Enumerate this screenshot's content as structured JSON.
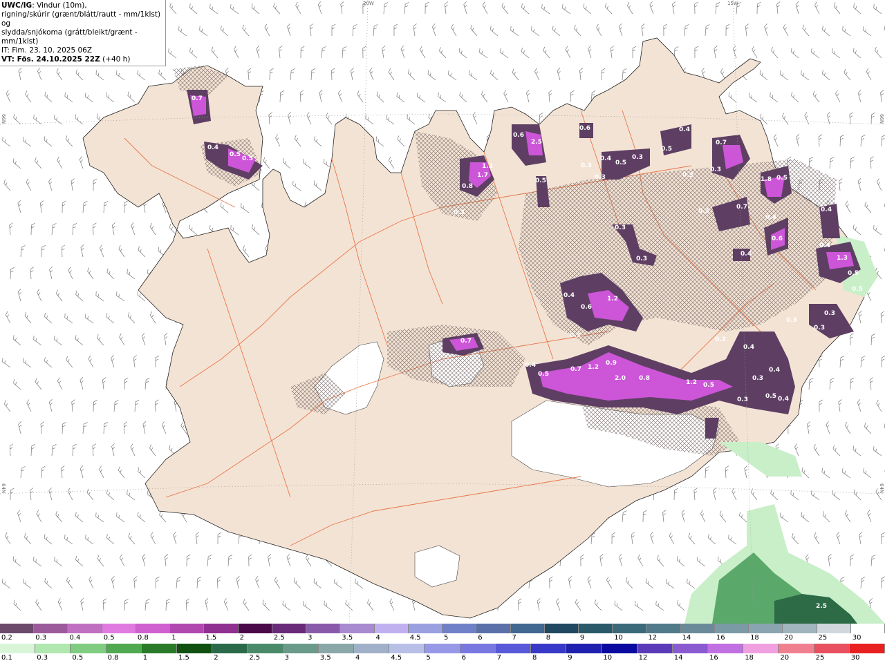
{
  "header": {
    "model": "UWC/IG",
    "desc1": ": Vindur (10m),",
    "desc2": "rigning/skúrir (grænt/blátt/rautt - mm/1klst) og",
    "desc3": "slydda/snjókoma (grátt/bleikt/grænt - mm/1klst)",
    "it": "IT: Fim. 23. 10. 2025 06Z",
    "vt_label": "VT: Fös. 24.10.2025 22Z",
    "vt_offset": "(+40 h)"
  },
  "graticule": {
    "lon_20w": "20W",
    "lon_15w": "15W",
    "lat_66n_left": "66N",
    "lat_66n_right": "66N",
    "lat_64n_left": "64N",
    "lat_64n_right": "64N"
  },
  "field_labels": [
    "0.7",
    "0.4",
    "0.5",
    "0.5",
    "0.6",
    "2.5",
    "1.2",
    "1.7",
    "0.8",
    "0.5",
    "0.3",
    "0.6",
    "0.3",
    "0.4",
    "0.5",
    "0.3",
    "0.3",
    "0.4",
    "0.5",
    "0.7",
    "0.3",
    "0.3",
    "1.8",
    "0.5",
    "0.3",
    "0.7",
    "0.4",
    "0.4",
    "0.6",
    "0.3",
    "0.3",
    "0.4",
    "0.4",
    "1.3",
    "0.5",
    "0.5",
    "0.4",
    "0.6",
    "1.2",
    "0.3",
    "0.7",
    "0.4",
    "0.5",
    "0.7",
    "1.2",
    "0.9",
    "2.0",
    "0.8",
    "1.2",
    "0.5",
    "0.2",
    "0.4",
    "0.3",
    "0.4",
    "0.5",
    "0.4",
    "0.3",
    "0.3",
    "0.3",
    "0.3",
    "2.5"
  ],
  "snow_scale": {
    "labels": [
      "0.2",
      "0.3",
      "0.4",
      "0.5",
      "0.8",
      "1",
      "1.5",
      "2",
      "2.5",
      "3",
      "3.5",
      "4",
      "4.5",
      "5",
      "6",
      "7",
      "8",
      "9",
      "10",
      "12",
      "14",
      "16",
      "18",
      "20",
      "25",
      "30"
    ],
    "colors": [
      "#6b4a6b",
      "#9b5b9b",
      "#c070c0",
      "#e07ae0",
      "#d060d0",
      "#b048b0",
      "#903090",
      "#4a0a4a",
      "#6a2a7a",
      "#8a5aaa",
      "#a88ad0",
      "#c0b0f0",
      "#9aa0e0",
      "#7080c8",
      "#5a70a8",
      "#406890",
      "#204860",
      "#2a5a6a",
      "#3a6a7a",
      "#507a8a",
      "#6a8a9a",
      "#7a9aa5",
      "#8aa5b0",
      "#a0b5bd",
      "#d0d8dc",
      "#ffffff"
    ]
  },
  "rain_scale": {
    "labels": [
      "0.1",
      "0.3",
      "0.5",
      "0.8",
      "1",
      "1.5",
      "2",
      "2.5",
      "3",
      "3.5",
      "4",
      "4.5",
      "5",
      "6",
      "7",
      "8",
      "9",
      "10",
      "12",
      "14",
      "16",
      "18",
      "20",
      "25",
      "30"
    ],
    "colors": [
      "#d8f5d8",
      "#b0e8b0",
      "#80cc80",
      "#50a850",
      "#2a7a2a",
      "#105010",
      "#2a6a4a",
      "#4a8a6a",
      "#6a9a8a",
      "#8aa8a8",
      "#a0b0c8",
      "#b8c0e8",
      "#9898e8",
      "#7878e0",
      "#5858d8",
      "#3838c8",
      "#2020b0",
      "#0a0aa0",
      "#5a3ab8",
      "#8a5ad0",
      "#c070e0",
      "#f0a0e0",
      "#f08090",
      "#e85060",
      "#e82020"
    ]
  },
  "colors": {
    "land": "#f3e3d4",
    "ocean": "#ffffff",
    "road": "#e8764a",
    "snow_light": "#5e3f63",
    "snow_mid": "#8e4a93",
    "snow_strong": "#cc55d8",
    "rain_light": "#c9efc9",
    "rain_mid": "#5aa86a",
    "rain_strong": "#2c6b46"
  }
}
